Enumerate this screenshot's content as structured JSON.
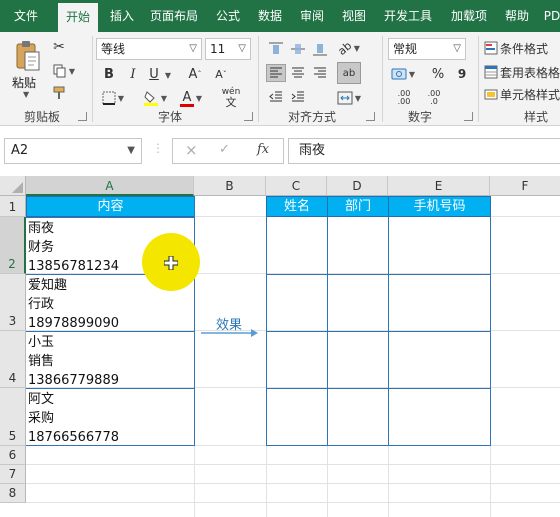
{
  "tabs": [
    "文件",
    "开始",
    "插入",
    "页面布局",
    "公式",
    "数据",
    "审阅",
    "视图",
    "开发工具",
    "加载项",
    "帮助",
    "PD"
  ],
  "active_tab": "开始",
  "ribbon": {
    "clipboard": {
      "paste_label": "粘贴",
      "group_label": "剪贴板"
    },
    "font": {
      "font_name": "等线",
      "font_size": "11",
      "bold": "B",
      "italic": "I",
      "underline": "U",
      "increase": "A",
      "decrease": "A",
      "font_color": "A",
      "phonetic": "wén",
      "group_label": "字体"
    },
    "alignment": {
      "wrap": "ab",
      "group_label": "对齐方式"
    },
    "number": {
      "format": "常规",
      "percent": "%",
      "comma": "9",
      "dec_inc": ".00",
      "dec_dec": ".00",
      "group_label": "数字"
    },
    "styles": {
      "conditional": "条件格式",
      "table": "套用表格格",
      "cell": "单元格样式",
      "group_label": "样式"
    }
  },
  "formula_bar": {
    "name_box": "A2",
    "cancel": "×",
    "enter": "✓",
    "fx": "fx",
    "content": "雨夜"
  },
  "columns": [
    "A",
    "B",
    "C",
    "D",
    "E",
    "F"
  ],
  "rows": [
    "1",
    "2",
    "3",
    "4",
    "5",
    "6",
    "7",
    "8"
  ],
  "sheet": {
    "a1": "内容",
    "entries": [
      {
        "name": "雨夜",
        "dept": "财务",
        "phone": "13856781234"
      },
      {
        "name": "爱知趣",
        "dept": "行政",
        "phone": "18978899090"
      },
      {
        "name": "小玉",
        "dept": "销售",
        "phone": "13866779889"
      },
      {
        "name": "阿文",
        "dept": "采购",
        "phone": "18766566778"
      }
    ],
    "arrow_label": "效果",
    "result_headers": [
      "姓名",
      "部门",
      "手机号码"
    ]
  },
  "colors": {
    "excel_green": "#217346",
    "header_fill": "#00b0f0",
    "border_blue": "#2e75b6",
    "cursor_highlight": "#f5e600"
  }
}
